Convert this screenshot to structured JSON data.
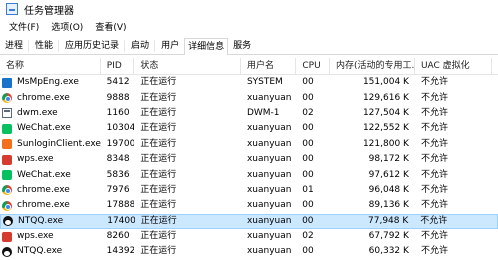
{
  "window": {
    "title": "任务管理器"
  },
  "menu": [
    "文件(F)",
    "选项(O)",
    "查看(V)"
  ],
  "tabs": [
    "进程",
    "性能",
    "应用历史记录",
    "启动",
    "用户",
    "详细信息",
    "服务"
  ],
  "active_tab": "详细信息",
  "columns": {
    "name": "名称",
    "pid": "PID",
    "status": "状态",
    "user": "用户名",
    "cpu": "CPU",
    "mem": "内存(活动的专用工...",
    "uac": "UAC 虚拟化"
  },
  "rows": [
    {
      "icon": "msmp-icon",
      "name": "MsMpEng.exe",
      "pid": "5412",
      "status": "正在运行",
      "user": "SYSTEM",
      "cpu": "00",
      "mem": "151,004 K",
      "uac": "不允许"
    },
    {
      "icon": "chrome-icon",
      "name": "chrome.exe",
      "pid": "9888",
      "status": "正在运行",
      "user": "xuanyuan",
      "cpu": "00",
      "mem": "129,616 K",
      "uac": "不允许"
    },
    {
      "icon": "window-icon",
      "name": "dwm.exe",
      "pid": "1160",
      "status": "正在运行",
      "user": "DWM-1",
      "cpu": "02",
      "mem": "127,504 K",
      "uac": "不允许"
    },
    {
      "icon": "wechat-icon",
      "name": "WeChat.exe",
      "pid": "10304",
      "status": "正在运行",
      "user": "xuanyuan",
      "cpu": "00",
      "mem": "122,552 K",
      "uac": "不允许"
    },
    {
      "icon": "sunlogin-icon",
      "name": "SunloginClient.exe",
      "pid": "19700",
      "status": "正在运行",
      "user": "xuanyuan",
      "cpu": "00",
      "mem": "121,800 K",
      "uac": "不允许"
    },
    {
      "icon": "wps-icon",
      "name": "wps.exe",
      "pid": "8348",
      "status": "正在运行",
      "user": "xuanyuan",
      "cpu": "00",
      "mem": "98,172 K",
      "uac": "不允许"
    },
    {
      "icon": "wechat-icon",
      "name": "WeChat.exe",
      "pid": "5836",
      "status": "正在运行",
      "user": "xuanyuan",
      "cpu": "00",
      "mem": "97,612 K",
      "uac": "不允许"
    },
    {
      "icon": "chrome-icon",
      "name": "chrome.exe",
      "pid": "7976",
      "status": "正在运行",
      "user": "xuanyuan",
      "cpu": "01",
      "mem": "96,048 K",
      "uac": "不允许"
    },
    {
      "icon": "chrome-icon",
      "name": "chrome.exe",
      "pid": "17888",
      "status": "正在运行",
      "user": "xuanyuan",
      "cpu": "00",
      "mem": "89,136 K",
      "uac": "不允许"
    },
    {
      "icon": "qq-icon",
      "name": "NTQQ.exe",
      "pid": "17400",
      "status": "正在运行",
      "user": "xuanyuan",
      "cpu": "00",
      "mem": "77,948 K",
      "uac": "不允许",
      "selected": true
    },
    {
      "icon": "wps-icon",
      "name": "wps.exe",
      "pid": "8260",
      "status": "正在运行",
      "user": "xuanyuan",
      "cpu": "02",
      "mem": "67,792 K",
      "uac": "不允许"
    },
    {
      "icon": "qq-icon",
      "name": "NTQQ.exe",
      "pid": "14392",
      "status": "正在运行",
      "user": "xuanyuan",
      "cpu": "00",
      "mem": "60,332 K",
      "uac": "不允许"
    }
  ]
}
